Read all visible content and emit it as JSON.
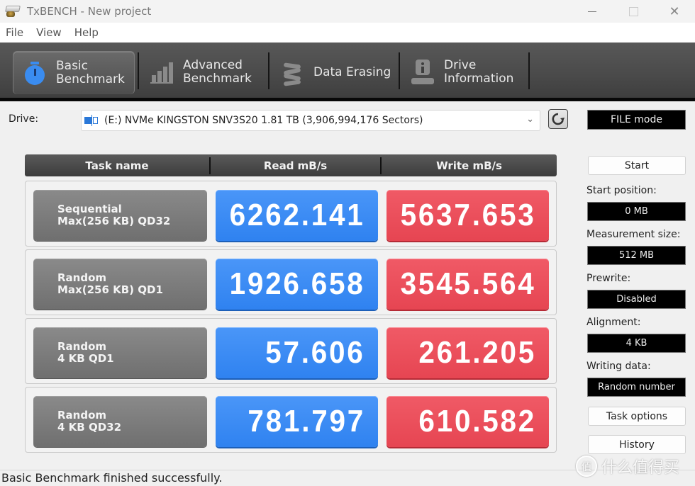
{
  "window": {
    "title": "TxBENCH - New project",
    "controls": [
      "minimize",
      "maximize",
      "close"
    ]
  },
  "menu": [
    "File",
    "View",
    "Help"
  ],
  "tabs": [
    {
      "label": "Basic\nBenchmark",
      "icon": "stopwatch-icon",
      "active": true
    },
    {
      "label": "Advanced\nBenchmark",
      "icon": "bar-chart-icon",
      "active": false
    },
    {
      "label": "Data Erasing",
      "icon": "eraser-icon",
      "active": false
    },
    {
      "label": "Drive\nInformation",
      "icon": "drive-info-icon",
      "active": false
    }
  ],
  "drive": {
    "label": "Drive:",
    "selected": "(E:) NVMe KINGSTON SNV3S20  1.81 TB (3,906,994,176 Sectors)",
    "mode": "FILE mode"
  },
  "table": {
    "headers": [
      "Task name",
      "Read mB/s",
      "Write mB/s"
    ],
    "rows": [
      {
        "task_line1": "Sequential",
        "task_line2": "Max(256 KB) QD32",
        "read": "6262.141",
        "write": "5637.653"
      },
      {
        "task_line1": "Random",
        "task_line2": "Max(256 KB) QD1",
        "read": "1926.658",
        "write": "3545.564"
      },
      {
        "task_line1": "Random",
        "task_line2": "4 KB QD1",
        "read": "57.606",
        "write": "261.205"
      },
      {
        "task_line1": "Random",
        "task_line2": "4 KB QD32",
        "read": "781.797",
        "write": "610.582"
      }
    ]
  },
  "settings": {
    "start_button": "Start",
    "start_position": {
      "label": "Start position:",
      "value": "0 MB"
    },
    "measurement_size": {
      "label": "Measurement size:",
      "value": "512 MB"
    },
    "prewrite": {
      "label": "Prewrite:",
      "value": "Disabled"
    },
    "alignment": {
      "label": "Alignment:",
      "value": "4 KB"
    },
    "writing_data": {
      "label": "Writing data:",
      "value": "Random number"
    },
    "task_options_button": "Task options",
    "history_button": "History"
  },
  "status": "Basic Benchmark finished successfully.",
  "watermark": {
    "badge": "值",
    "text": "什么值得买"
  },
  "colors": {
    "read": "#3a8cf4",
    "write": "#ea4f5b",
    "task": "#7c7c7c",
    "toolbar": "#4a4a4a",
    "accent_icon": "#3a8cf0"
  }
}
